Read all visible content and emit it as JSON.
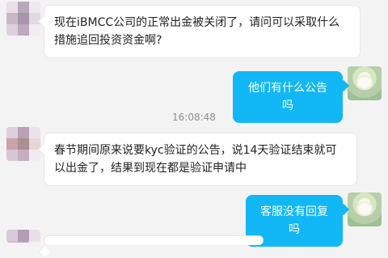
{
  "conversation": {
    "messages": [
      {
        "side": "left",
        "text": "现在iBMCC公司的正常出金被关闭了，请问可以采取什么措施追回投资资金啊?"
      },
      {
        "side": "right",
        "text": "他们有什么公告吗"
      },
      {
        "side": "left",
        "text": "春节期间原来说要kyc验证的公告，说14天验证结束就可以出金了，结果到现在都是验证申请中"
      },
      {
        "side": "right",
        "text": "客服没有回复吗"
      }
    ],
    "timestamp": "16:08:48"
  },
  "colors": {
    "outgoing_bubble": "#12b7f5",
    "incoming_bubble": "#ffffff",
    "background": "#f3f3f3"
  },
  "icons": {
    "incoming_avatar": "blurred-mosaic-avatar",
    "outgoing_avatar": "anime-style-avatar"
  }
}
